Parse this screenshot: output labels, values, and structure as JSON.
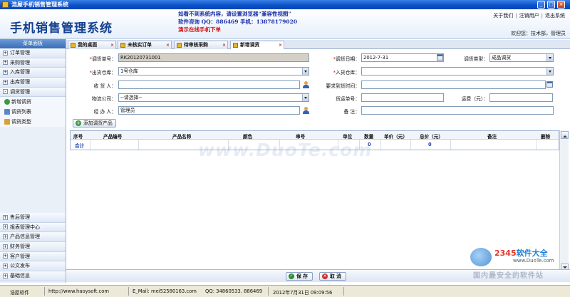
{
  "window": {
    "title": "浩屋手机销售管理系统",
    "buttons": [
      "_",
      "□",
      "×"
    ]
  },
  "header": {
    "brand": "手机销售管理系统",
    "banner_line1": "如看不到系统内容，请设置浏览器“兼容性视图”",
    "banner_line2": "软件咨询 QQ：886469 手机：13878179020",
    "banner_line3": "演示在线手机下单",
    "links": [
      "关于我们",
      "注销用户",
      "退出系统"
    ],
    "welcome": "欢迎您：技术部，管理员"
  },
  "sidebar": {
    "title": "菜单面板",
    "top_items": [
      "订单管理",
      "采购管理",
      "入库管理",
      "出库管理",
      "调货管理"
    ],
    "sub_items": [
      "新增调货",
      "调货列表",
      "调货类型"
    ],
    "bottom_items": [
      "售后管理",
      "报表管理中心",
      "产品信息管理",
      "财务管理",
      "客户管理",
      "公文发布",
      "基础信息"
    ],
    "expand_symbol": "+",
    "collapse_symbol": "-"
  },
  "tabs": [
    "我的桌面",
    "未核实订单",
    "待审核采购",
    "新增调货"
  ],
  "tab_close": "×",
  "form": {
    "required_mark": "*",
    "order_no_label": "调货单号：",
    "order_no_value": "RK20120731001",
    "date_label": "调货日期：",
    "date_value": "2012-7-31",
    "type_label": "调货类型：",
    "type_value": "成品调货",
    "out_wh_label": "出货仓库：",
    "out_wh_value": "1号仓库",
    "in_wh_label": "入货仓库：",
    "in_wh_value": "",
    "receiver_label": "收 货 人：",
    "receiver_value": "",
    "arrive_label": "要求到货时间：",
    "arrive_value": "",
    "logistics_label": "物流公司：",
    "logistics_value": "--请选择--",
    "ship_no_label": "货运单号：",
    "ship_no_value": "",
    "freight_label": "运费（元）：",
    "freight_value": "",
    "handler_label": "经 办 人：",
    "handler_value": "管理员",
    "remark_label": "备    注：",
    "remark_value": ""
  },
  "add_product_button": "添加调货产品",
  "grid": {
    "columns": [
      "序号",
      "产品编号",
      "产品名称",
      "颜色",
      "串号",
      "单位",
      "数量",
      "单价（元）",
      "总价（元）",
      "备注",
      "删除"
    ],
    "summary_label": "合计",
    "qty_total": "0",
    "amount_total": "0"
  },
  "watermark": "www.DuoTe.com",
  "actions": {
    "save": "保 存",
    "cancel": "取 消",
    "save_icon": "✓",
    "cancel_icon": "×"
  },
  "corner_logo": {
    "brand_digits": "2345",
    "brand_text": "软件大全",
    "url": "www.DuoTe.com",
    "slogan": "国内最安全的软件站"
  },
  "statusbar": {
    "company": "浩屋软件",
    "website": "http://www.haoysoft.com",
    "email": "E_Mail: mei52580163.com",
    "qq": "QQ: 34860533. 886469",
    "datetime": "2012年7月31日 09:09:56"
  }
}
